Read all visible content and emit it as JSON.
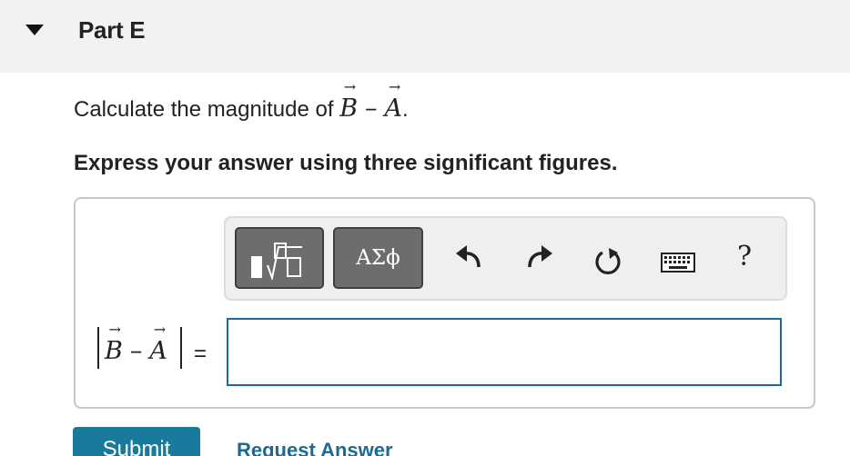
{
  "part": {
    "title": "Part E"
  },
  "question": {
    "prefix": "Calculate the magnitude of ",
    "vec_b": "B",
    "vec_a": "A",
    "minus": "–",
    "arrow": "→",
    "suffix": "."
  },
  "instruction": "Express your answer using three significant figures.",
  "toolbar": {
    "greek_label": "ΑΣϕ",
    "help_label": "?",
    "icons": [
      "templates-icon",
      "greek-symbols-icon",
      "undo-icon",
      "redo-icon",
      "reset-icon",
      "keyboard-icon",
      "help-icon"
    ]
  },
  "answer": {
    "label_vec_b": "B",
    "label_vec_a": "A",
    "label_minus": "–",
    "equals": "=",
    "value": "",
    "placeholder": ""
  },
  "actions": {
    "submit_label": "Submit",
    "request_label": "Request Answer"
  },
  "colors": {
    "accent": "#197a9c",
    "link": "#1a6a91",
    "header_bg": "#f2f2f2",
    "toolbar_button": "#6d6d6d"
  }
}
